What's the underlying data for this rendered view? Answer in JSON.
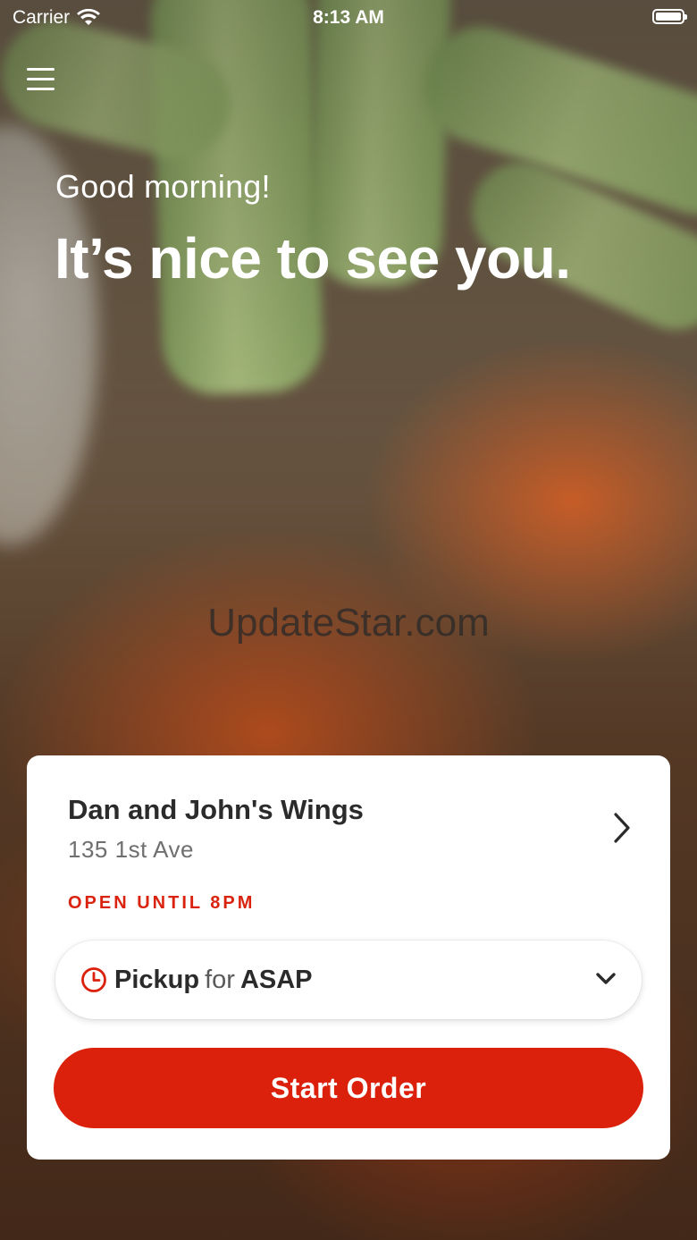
{
  "status_bar": {
    "carrier": "Carrier",
    "time": "8:13 AM"
  },
  "header": {
    "menu_icon": "hamburger-menu-icon"
  },
  "hero": {
    "greeting": "Good morning!",
    "headline": "It’s nice to see you."
  },
  "watermark": "UpdateStar.com",
  "store_card": {
    "name": "Dan and John's Wings",
    "address": "135 1st Ave",
    "hours": "OPEN UNTIL 8PM",
    "order_mode": {
      "mode": "Pickup",
      "connector": "for",
      "time": "ASAP"
    },
    "start_order_label": "Start Order"
  },
  "colors": {
    "accent": "#db200b",
    "text": "#2b2b2b",
    "muted": "#6f6f6f"
  }
}
